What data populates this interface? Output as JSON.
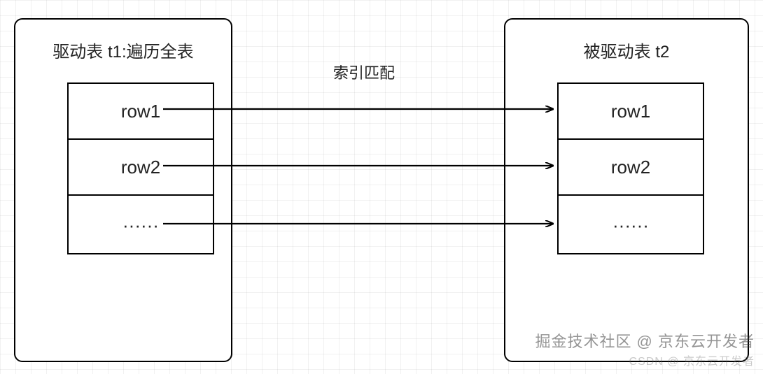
{
  "chart_data": {
    "type": "diagram",
    "title": "",
    "nodes": [
      {
        "id": "t1",
        "label": "驱动表 t1:遍历全表",
        "rows": [
          "row1",
          "row2",
          "······"
        ]
      },
      {
        "id": "t2",
        "label": "被驱动表 t2",
        "rows": [
          "row1",
          "row2",
          "······"
        ]
      }
    ],
    "edges": [
      {
        "from": "t1.row1",
        "to": "t2.row1",
        "label": "索引匹配"
      },
      {
        "from": "t1.row2",
        "to": "t2.row2",
        "label": "索引匹配"
      },
      {
        "from": "t1.row3",
        "to": "t2.row3",
        "label": "索引匹配"
      }
    ],
    "arrow_label": "索引匹配"
  },
  "left_box": {
    "title": "驱动表 t1:遍历全表",
    "rows": [
      "row1",
      "row2",
      "······"
    ]
  },
  "right_box": {
    "title": "被驱动表 t2",
    "rows": [
      "row1",
      "row2",
      "······"
    ]
  },
  "arrow_label": "索引匹配",
  "watermarks": {
    "primary": "掘金技术社区 @ 京东云开发者",
    "secondary": "CSDN @ 京东云开发者"
  },
  "colors": {
    "stroke": "#000000",
    "text": "#222222",
    "grid": "rgba(0,0,0,0.055)"
  }
}
